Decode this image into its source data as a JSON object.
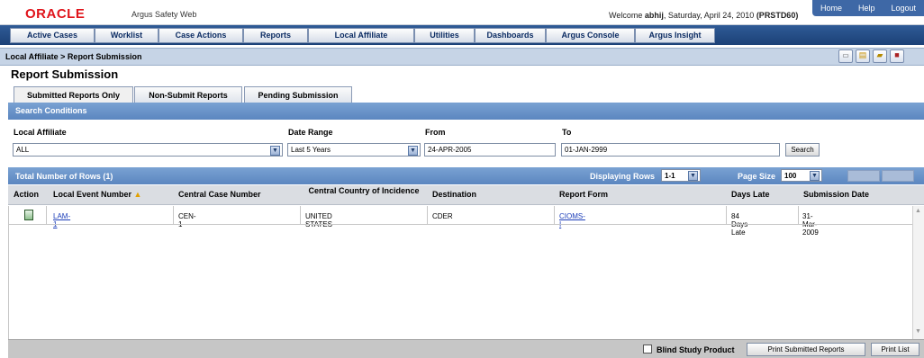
{
  "header": {
    "logo": "ORACLE",
    "app_name": "Argus Safety Web",
    "welcome_prefix": "Welcome",
    "user": "abhij",
    "date_text": ", Saturday, April 24, 2010",
    "server": "(PRSTD60)",
    "links": [
      "Home",
      "Help",
      "Logout"
    ]
  },
  "menu": [
    "Active Cases",
    "Worklist",
    "Case Actions",
    "Reports",
    "Local Affiliate",
    "Utilities",
    "Dashboards",
    "Argus Console",
    "Argus Insight"
  ],
  "breadcrumb": "Local Affiliate > Report Submission",
  "page_title": "Report Submission",
  "tabs": [
    "Submitted Reports Only",
    "Non-Submit Reports",
    "Pending Submission"
  ],
  "search": {
    "header": "Search Conditions",
    "local_affiliate_label": "Local Affiliate",
    "local_affiliate_value": "ALL",
    "date_range_label": "Date Range",
    "date_range_value": "Last 5 Years",
    "from_label": "From",
    "from_value": "24-APR-2005",
    "to_label": "To",
    "to_value": "01-JAN-2999",
    "search_button": "Search"
  },
  "grid": {
    "total_label": "Total Number of Rows (1)",
    "displaying_label": "Displaying Rows",
    "displaying_value": "1-1",
    "page_size_label": "Page Size",
    "page_size_value": "100",
    "columns": [
      "Action",
      "Local Event Number",
      "Central Case Number",
      "Central Country of Incidence",
      "Destination",
      "Report Form",
      "Days Late",
      "Submission Date"
    ],
    "rows": [
      {
        "local_event_number": "LAM-1",
        "central_case_number": "CEN-1",
        "country": "UNITED STATES",
        "destination": "CDER",
        "report_form": "CIOMS-I",
        "days_late": "84 Days Late",
        "submission_date": "31-Mar-2009"
      }
    ]
  },
  "footer": {
    "blind_study_label": "Blind Study Product",
    "print_submitted": "Print Submitted Reports",
    "print_list": "Print List"
  },
  "colors": {
    "menu_bar": "#1c4177",
    "section_header": "#6a94c9",
    "breadcrumb_bar": "#c6d4e6",
    "oracle_red": "#e0141b"
  }
}
